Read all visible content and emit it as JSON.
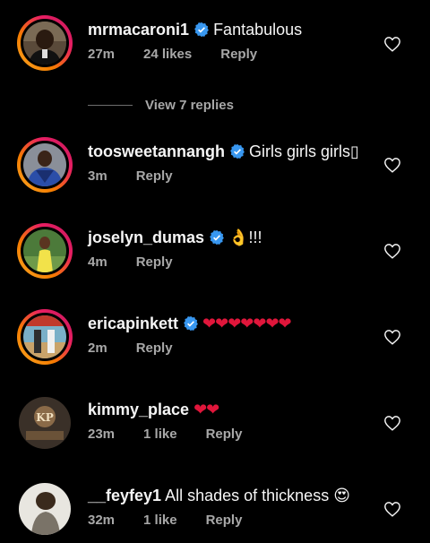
{
  "comments": [
    {
      "username": "mrmacaroni1",
      "text": "Fantabulous",
      "time": "27m",
      "likes": "24 likes",
      "reply": "Reply"
    },
    {
      "username": "toosweetannangh",
      "text": "Girls girls girls▯",
      "time": "3m",
      "reply": "Reply"
    },
    {
      "username": "joselyn_dumas",
      "text": "!!!",
      "emoji": "ok-hand",
      "time": "4m",
      "reply": "Reply"
    },
    {
      "username": "ericapinkett",
      "hearts": "❤❤❤❤❤❤❤",
      "time": "2m",
      "reply": "Reply"
    },
    {
      "username": "kimmy_place",
      "hearts": "❤❤",
      "time": "23m",
      "likes": "1 like",
      "reply": "Reply"
    },
    {
      "username": "__feyfey1",
      "text": "All shades of thickness",
      "emoji": "heart-eyes",
      "time": "32m",
      "likes": "1 like",
      "reply": "Reply"
    }
  ],
  "view_replies": "View 7 replies",
  "colors": {
    "background": "#000000",
    "text": "#f5f5f5",
    "muted": "#a8a8a8",
    "verified": "#3897f0",
    "heart": "#e0163b"
  }
}
